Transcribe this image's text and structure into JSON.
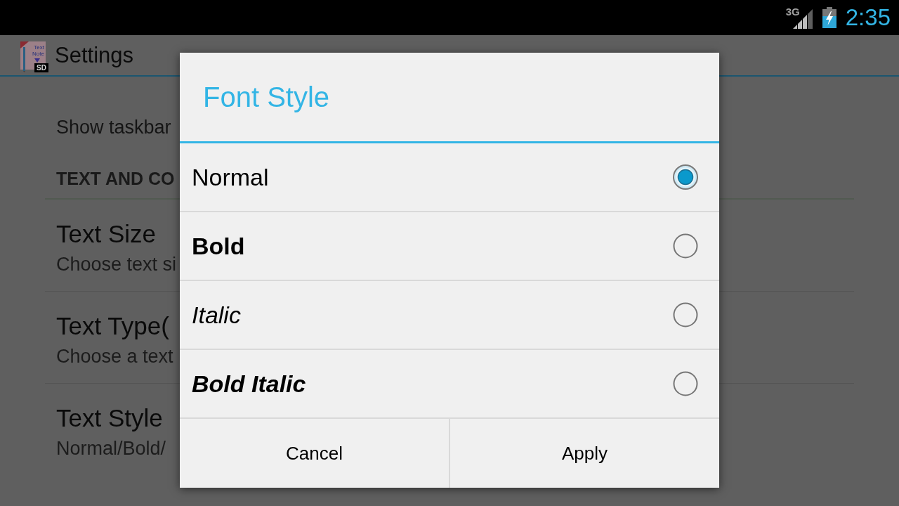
{
  "status_bar": {
    "network_type": "3G",
    "time": "2:35"
  },
  "action_bar": {
    "app_icon": {
      "caption": "Text Note",
      "badge": "SD"
    },
    "title": "Settings"
  },
  "settings": {
    "cut_item": {
      "summary": "Show taskbar"
    },
    "section_header": "TEXT AND CO",
    "items": [
      {
        "title": "Text Size",
        "summary": "Choose text si"
      },
      {
        "title": "Text Type(",
        "summary": "Choose a text"
      },
      {
        "title": "Text Style",
        "summary": "Normal/Bold/"
      }
    ]
  },
  "dialog": {
    "title": "Font Style",
    "options": [
      {
        "label": "Normal",
        "kind": "normal",
        "selected": true
      },
      {
        "label": "Bold",
        "kind": "bold",
        "selected": false
      },
      {
        "label": "Italic",
        "kind": "italic",
        "selected": false
      },
      {
        "label": "Bold Italic",
        "kind": "bold-italic",
        "selected": false
      }
    ],
    "buttons": [
      "Cancel",
      "Apply"
    ]
  }
}
